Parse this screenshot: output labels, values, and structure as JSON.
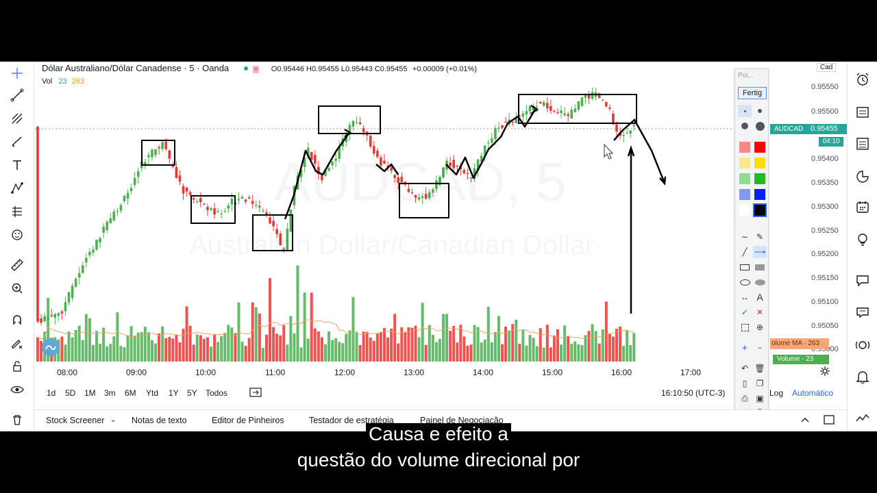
{
  "header": {
    "symbol_title": "Dólar Australiano/Dólar Canadense · 5 · Oanda",
    "ohlc": "O0.95446 H0.95455 L0.95443 C0.95455",
    "change": "+0.00009 (+0.01%)",
    "vol_label": "Vol",
    "vol_value": "23",
    "vol_ma": "263"
  },
  "watermark": {
    "ticker": "AUDCAD, 5",
    "name": "Australian Dollar/Canadian Dollar"
  },
  "price_scale": {
    "currency": "Cad",
    "ticks": [
      "0.95550",
      "0.95500",
      "0.95400",
      "0.95350",
      "0.95300",
      "0.95250",
      "0.95200",
      "0.95150",
      "0.95100",
      "0.95050",
      "0.95000"
    ],
    "symbol_badge": "AUDCAD",
    "last_price": "0.95455",
    "countdown": "04:10",
    "volume_ma_label": "olume MA · 263",
    "volume_label": "Volume · 23"
  },
  "time_axis": [
    "08:00",
    "09:00",
    "10:00",
    "11:00",
    "12:00",
    "13:00",
    "14:00",
    "15:00",
    "16:00",
    "17:00"
  ],
  "range_bar": {
    "ranges": [
      "1d",
      "5D",
      "1M",
      "3m",
      "6M",
      "Ytd",
      "1Y",
      "5Y",
      "Todos"
    ],
    "clock": "16:10:50 (UTC-3)",
    "log": "Log",
    "auto": "Automático"
  },
  "palette": {
    "placeholder": "Poi...",
    "done": "Fertig",
    "colors": [
      "#ff0000",
      "#ffdd00",
      "#22bb22",
      "#0022ff",
      "#000000"
    ]
  },
  "bottom_tabs": [
    "Stock Screener",
    "Notas de texto",
    "Editor de Pinheiros",
    "Testador de estratégia",
    "Painel de Negociação"
  ],
  "subtitles": [
    "Causa e efeito a",
    "questão do volume direcional por"
  ],
  "colors": {
    "up": "#4caf50",
    "down": "#e53935",
    "volume_up": "#66bb6a",
    "volume_down": "#ef5350",
    "accent": "#2962ff",
    "price_label": "#26a69a"
  }
}
